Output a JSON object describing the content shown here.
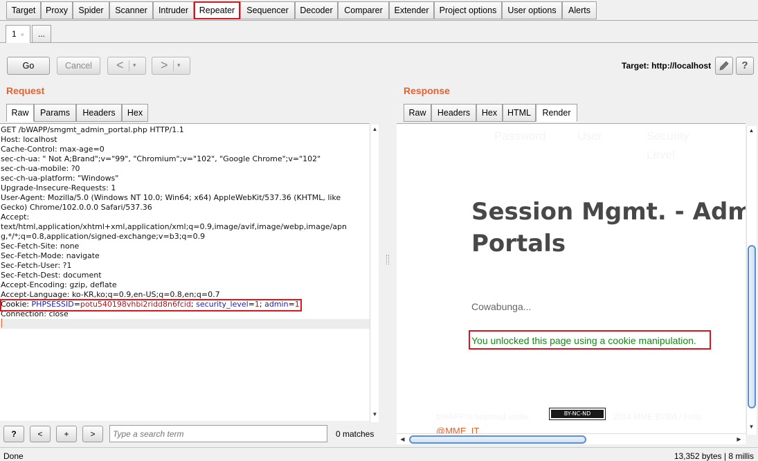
{
  "main_tabs": [
    "Target",
    "Proxy",
    "Spider",
    "Scanner",
    "Intruder",
    "Repeater",
    "Sequencer",
    "Decoder",
    "Comparer",
    "Extender",
    "Project options",
    "User options",
    "Alerts"
  ],
  "active_main_tab": "Repeater",
  "sub_tabs": {
    "first": "1",
    "first_close": "×",
    "more": "..."
  },
  "toolbar": {
    "go": "Go",
    "cancel": "Cancel",
    "back": "<",
    "forward": ">",
    "dropdown": "▾",
    "target": "Target: http://localhost",
    "edit_icon": "pencil-icon",
    "help": "?"
  },
  "request": {
    "title": "Request",
    "tabs": [
      "Raw",
      "Params",
      "Headers",
      "Hex"
    ],
    "active_tab": "Raw",
    "lines": [
      "GET /bWAPP/smgmt_admin_portal.php HTTP/1.1",
      "Host: localhost",
      "Cache-Control: max-age=0",
      "sec-ch-ua: \" Not A;Brand\";v=\"99\", \"Chromium\";v=\"102\", \"Google Chrome\";v=\"102\"",
      "sec-ch-ua-mobile: ?0",
      "sec-ch-ua-platform: \"Windows\"",
      "Upgrade-Insecure-Requests: 1",
      "User-Agent: Mozilla/5.0 (Windows NT 10.0; Win64; x64) AppleWebKit/537.36 (KHTML, like",
      "Gecko) Chrome/102.0.0.0 Safari/537.36",
      "Accept:",
      "text/html,application/xhtml+xml,application/xml;q=0.9,image/avif,image/webp,image/apn",
      "g,*/*;q=0.8,application/signed-exchange;v=b3;q=0.9",
      "Sec-Fetch-Site: none",
      "Sec-Fetch-Mode: navigate",
      "Sec-Fetch-User: ?1",
      "Sec-Fetch-Dest: document",
      "Accept-Encoding: gzip, deflate",
      "Accept-Language: ko-KR,ko;q=0.9,en-US;q=0.8,en;q=0.7"
    ],
    "cookie": {
      "label": "Cookie: ",
      "n1": "PHPSESSID",
      "eq1": "=",
      "v1": "potu540198vhbi2ridd8n6fcid",
      "sep1": "; ",
      "n2": "security_level",
      "eq2": "=",
      "v2": "1",
      "sep2": "; ",
      "n3": "admin",
      "eq3": "=",
      "v3": "1"
    },
    "after_cookie": "Connection: close"
  },
  "search": {
    "help": "?",
    "prev": "<",
    "add": "+",
    "next": ">",
    "placeholder": "Type a search term",
    "matches": "0 matches"
  },
  "response": {
    "title": "Response",
    "tabs": [
      "Raw",
      "Headers",
      "Hex",
      "HTML",
      "Render"
    ],
    "active_tab": "Render",
    "ghost_nav": [
      "Password",
      "User",
      "Security",
      "Level"
    ],
    "heading_line1": "Session Mgmt. - Adm",
    "heading_line2": "Portals",
    "cowabunga": "Cowabunga...",
    "unlocked": "You unlocked this page using a cookie manipulation.",
    "cc_badge": "BY-NC-ND",
    "footer_left": "bWAPP is licensed under",
    "footer_right": "2014 MME BVBA / Follo",
    "handle": "@MME_IT"
  },
  "status": {
    "left": "Done",
    "right": "13,352 bytes | 8 millis"
  },
  "colors": {
    "accent_orange": "#e8602c",
    "highlight_red": "#d8141c",
    "success_green": "#138a13",
    "scroll_blue": "#5b8ed2"
  }
}
